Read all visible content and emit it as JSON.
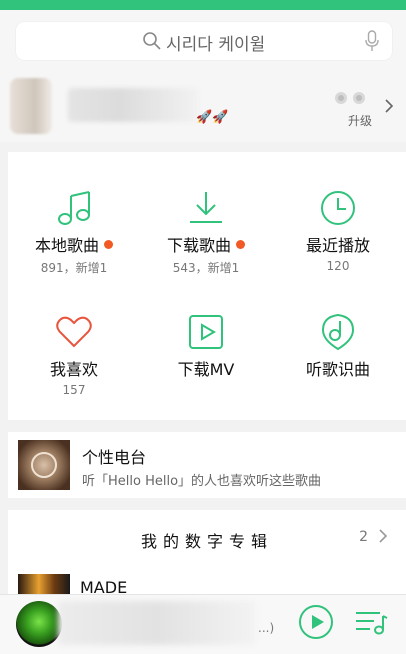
{
  "colors": {
    "accent": "#31c27c",
    "badge": "#f15a24"
  },
  "search": {
    "placeholder": "시리다 케이윌",
    "icon": "search-icon",
    "mic_icon": "microphone-icon"
  },
  "profile": {
    "upgrade_label": "升级",
    "badges": "vip-badge-icons",
    "rockets": "rocket-icons"
  },
  "grid": [
    {
      "label": "本地歌曲",
      "sub": "891，新增1",
      "icon": "music-note-icon",
      "dot": true
    },
    {
      "label": "下载歌曲",
      "sub": "543，新增1",
      "icon": "download-icon",
      "dot": true
    },
    {
      "label": "最近播放",
      "sub": "120",
      "icon": "clock-icon",
      "dot": false
    },
    {
      "label": "我喜欢",
      "sub": "157",
      "icon": "heart-icon",
      "dot": false
    },
    {
      "label": "下载MV",
      "sub": "",
      "icon": "mv-play-icon",
      "dot": false
    },
    {
      "label": "听歌识曲",
      "sub": "",
      "icon": "song-recognize-icon",
      "dot": false
    }
  ],
  "radio": {
    "title": "个性电台",
    "desc": "听「Hello Hello」的人也喜欢听这些歌曲"
  },
  "albums": {
    "title": "我的数字专辑",
    "count": "2"
  },
  "album_peek": {
    "name": "MADE"
  },
  "player": {
    "ellipsis": "...)",
    "play_icon": "play-icon",
    "list_icon": "playlist-icon"
  }
}
